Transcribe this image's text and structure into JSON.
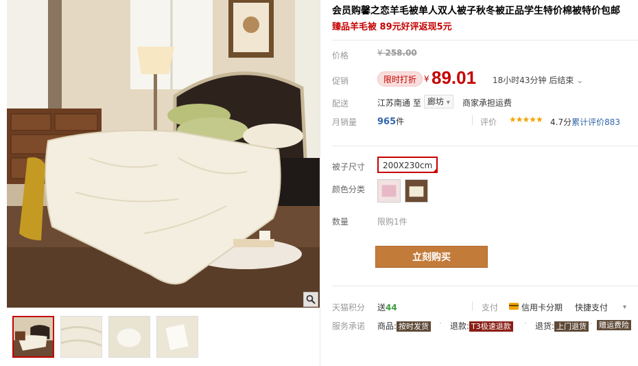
{
  "product": {
    "title": "会员购馨之恋羊毛被单人双人被子秋冬被正品学生特价棉被特价包邮",
    "subtitle": "臻品羊毛被 89元好评返现5元"
  },
  "price": {
    "label": "价格",
    "currency": "¥",
    "original": "258.00"
  },
  "promo": {
    "label": "促销",
    "tag": "限时打折",
    "currency": "¥",
    "price": "89.01",
    "countdown": "18小时43分钟 后结束",
    "countdown_arrow": "⌄"
  },
  "shipping": {
    "label": "配送",
    "from": "江苏南通 至",
    "to": "廊坊",
    "to_arrow": "▾",
    "fee": "商家承担运费"
  },
  "sales": {
    "label": "月销量",
    "count": "965",
    "unit": "件",
    "review_label": "评价",
    "stars": "★★★★★",
    "rating": "4.7分",
    "review_text": "累计评价",
    "review_count": "883"
  },
  "options": {
    "size_label": "被子尺寸",
    "size_value": "200X230cm",
    "color_label": "颜色分类",
    "quantity_label": "数量",
    "quantity_limit": "限购1件"
  },
  "buy_button": "立刻购买",
  "points": {
    "label": "天猫积分",
    "prefix": "送",
    "value": "44"
  },
  "payment": {
    "label": "支付",
    "card": "信用卡分期",
    "quick": "快捷支付",
    "arrow": "▾"
  },
  "promise": {
    "label": "服务承诺",
    "items": [
      {
        "prefix": "商品:",
        "tag": "按时发货"
      },
      {
        "prefix": "退款:",
        "tag": "T3极速退款"
      },
      {
        "prefix": "退货:",
        "tag": "上门退货"
      },
      {
        "prefix": "",
        "tag": "赠运费险"
      }
    ],
    "separator": "·"
  },
  "icons": {
    "zoom": "magnifier-icon",
    "card": "credit-card-icon"
  },
  "colors": {
    "accent_red": "#c40000",
    "buy_button": "#c37b3a",
    "points_green": "#3f9a3f",
    "link_blue": "#3366aa",
    "star": "#f0a400"
  }
}
